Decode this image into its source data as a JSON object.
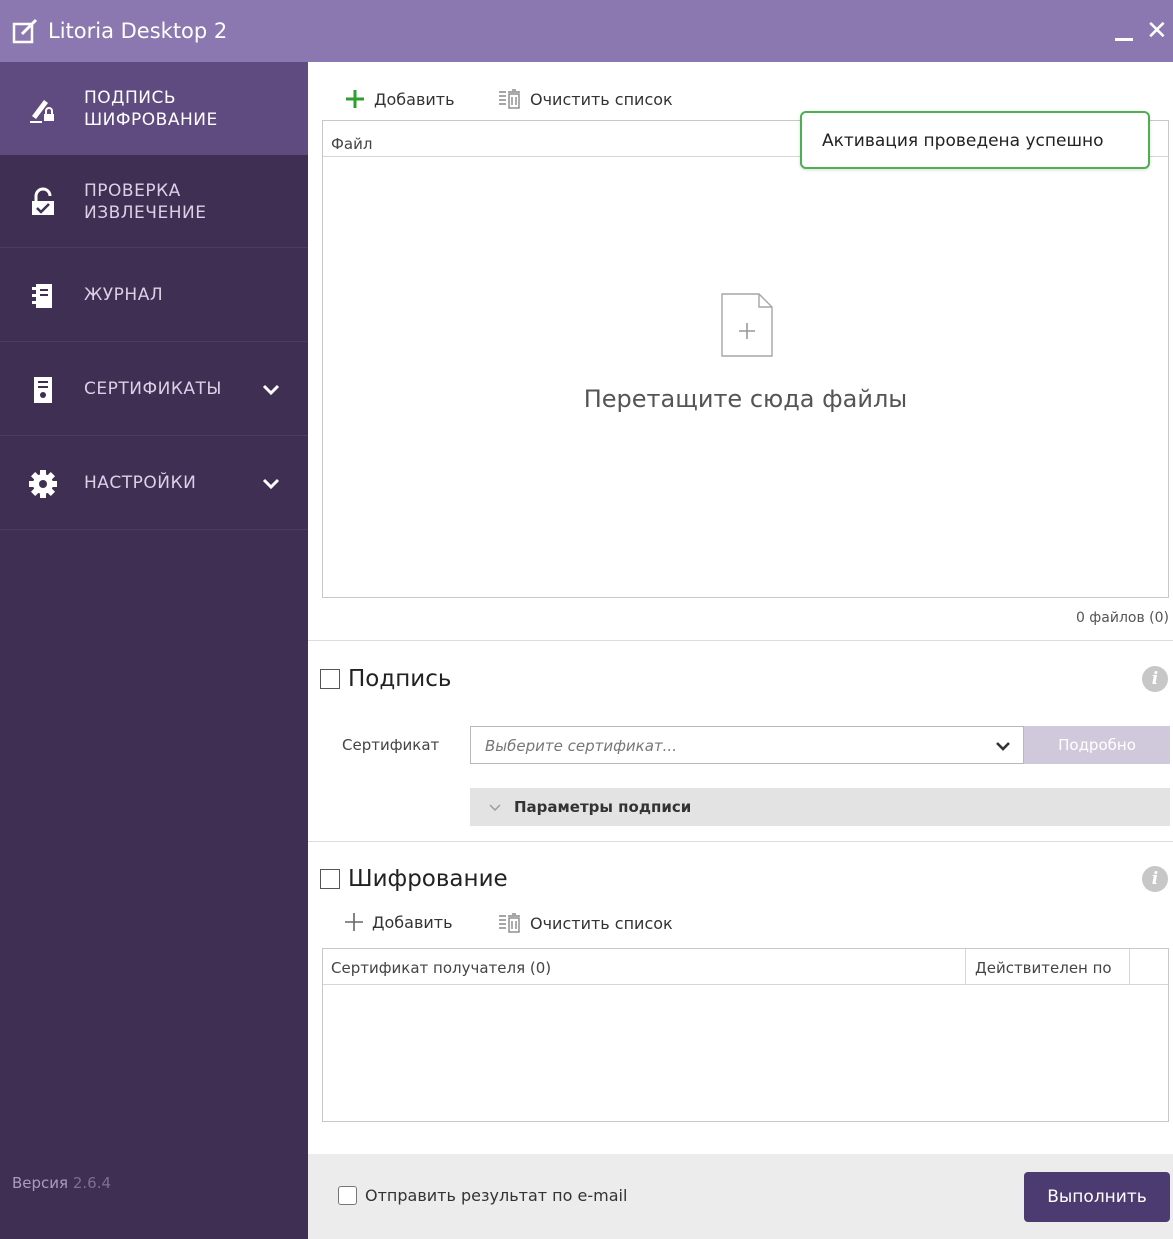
{
  "window": {
    "title": "Litoria Desktop 2",
    "close_glyph": "✕",
    "minimize_glyph": "—"
  },
  "sidebar": {
    "items": [
      {
        "line1": "ПОДПИСЬ",
        "line2": "ШИФРОВАНИЕ",
        "icon": "sign-pen-icon",
        "active": true
      },
      {
        "line1": "ПРОВЕРКА",
        "line2": "ИЗВЛЕЧЕНИЕ",
        "icon": "unlock-check-icon",
        "active": false
      },
      {
        "label": "ЖУРНАЛ",
        "icon": "journal-icon",
        "active": false
      },
      {
        "label": "СЕРТИФИКАТЫ",
        "icon": "certificate-icon",
        "active": false,
        "expandable": true
      },
      {
        "label": "НАСТРОЙКИ",
        "icon": "gear-icon",
        "active": false,
        "expandable": true
      }
    ],
    "version_label": "Версия",
    "version_number": "2.6.4"
  },
  "files": {
    "add_label": "Добавить",
    "clear_label": "Очистить список",
    "column_file": "Файл",
    "drop_text": "Перетащите сюда файлы",
    "count_text": "0 файлов (0)",
    "toast": "Активация проведена успешно"
  },
  "signature": {
    "title": "Подпись",
    "cert_label": "Сертификат",
    "cert_placeholder": "Выберите сертификат...",
    "details_label": "Подробно",
    "params_label": "Параметры подписи"
  },
  "encryption": {
    "title": "Шифрование",
    "add_label": "Добавить",
    "clear_label": "Очистить список",
    "col_recipient": "Сертификат получателя (0)",
    "col_valid": "Действителен по"
  },
  "footer": {
    "email_label": "Отправить результат по e-mail",
    "run_label": "Выполнить"
  },
  "colors": {
    "titlebar": "#8b78b0",
    "sidebar": "#3f2f52",
    "sidebar_active": "#5f4b80",
    "accent_green": "#4caf50",
    "run_button": "#4b3b70"
  }
}
